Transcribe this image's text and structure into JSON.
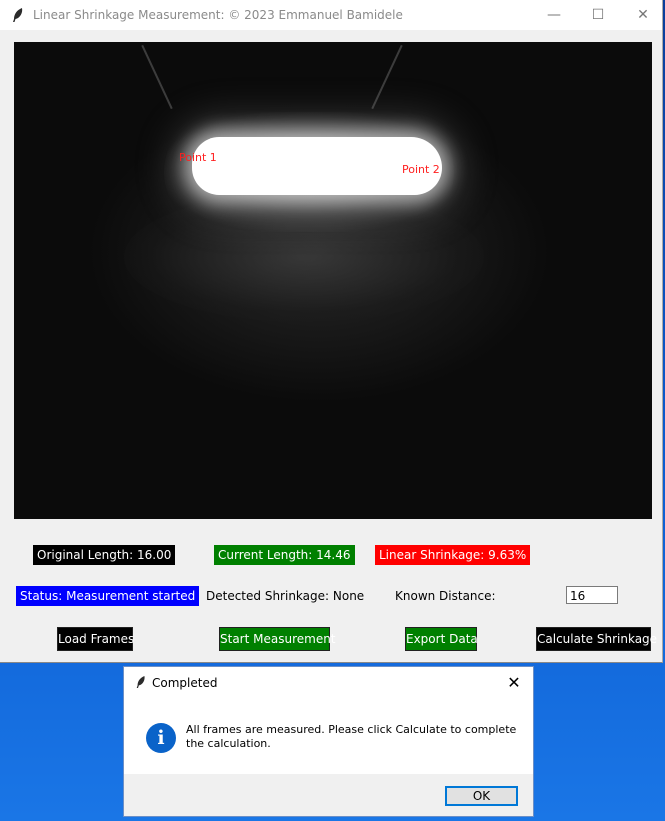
{
  "window": {
    "title": "Linear Shrinkage Measurement: © 2023 Emmanuel Bamidele",
    "minimize_glyph": "—",
    "maximize_glyph": "☐",
    "close_glyph": "✕"
  },
  "frame": {
    "point1_label": "Point 1",
    "point2_label": "Point 2"
  },
  "labels": {
    "original_length": "Original Length: 16.00",
    "current_length": "Current Length: 14.46",
    "linear_shrinkage": "Linear Shrinkage: 9.63%",
    "status": "Status: Measurement started",
    "detected_shrinkage": "Detected Shrinkage: None",
    "known_distance": "Known Distance:"
  },
  "inputs": {
    "known_distance_value": "16"
  },
  "buttons": {
    "load_frames": "Load Frames",
    "start_measurement": "Start Measurement",
    "export_data": "Export Data",
    "calculate_shrinkage": "Calculate Shrinkage"
  },
  "dialog": {
    "title": "Completed",
    "close_glyph": "✕",
    "icon_glyph": "i",
    "message": "All frames are measured. Please click Calculate to complete the calculation.",
    "ok_label": "OK"
  },
  "colors": {
    "original_length_bg": "#000000",
    "current_length_bg": "#008000",
    "linear_shrinkage_bg": "#ff0000",
    "status_bg": "#0000ff",
    "button_black": "#000000",
    "button_green": "#008000",
    "point_label": "#ff2020"
  },
  "icons": {
    "app": "feather-icon",
    "dialog_info": "info-icon"
  }
}
